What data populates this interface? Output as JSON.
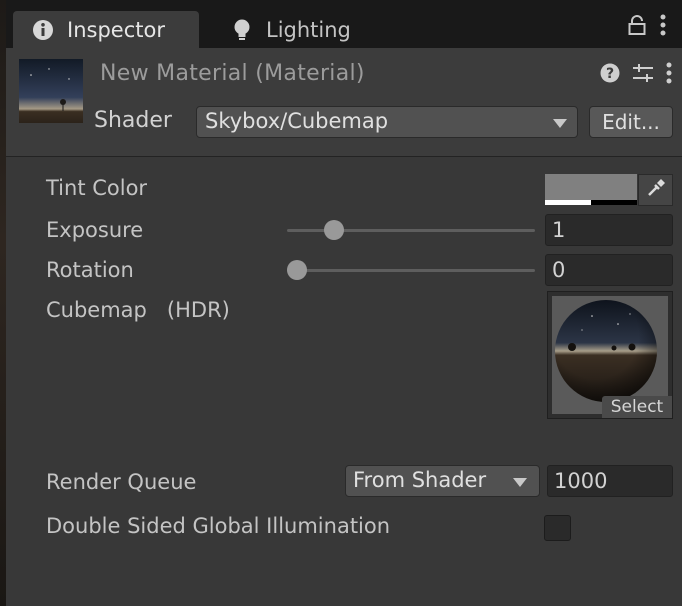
{
  "tabs": [
    {
      "label": "Inspector",
      "icon": "info-icon"
    },
    {
      "label": "Lighting",
      "icon": "lightbulb-icon"
    }
  ],
  "tabbar_icons": [
    "lock-icon",
    "kebab-menu-icon"
  ],
  "material": {
    "title": "New Material (Material)",
    "header_icons": [
      "help-icon",
      "preset-sliders-icon",
      "kebab-menu-icon"
    ],
    "shader_label": "Shader",
    "shader_value": "Skybox/Cubemap",
    "edit_label": "Edit..."
  },
  "properties": {
    "tint": {
      "label": "Tint Color",
      "color": "#808080",
      "alpha": 0.5
    },
    "exposure": {
      "label": "Exposure",
      "value": "1",
      "slider_fraction": 0.15
    },
    "rotation": {
      "label": "Rotation",
      "value": "0",
      "slider_fraction": 0.0
    },
    "cubemap": {
      "label": "Cubemap",
      "hint": "(HDR)",
      "select_label": "Select"
    },
    "render_queue": {
      "label": "Render Queue",
      "mode": "From Shader",
      "value": "1000"
    },
    "dsgi": {
      "label": "Double Sided Global Illumination",
      "checked": false
    }
  },
  "colors": {
    "background": "#383838",
    "tabbar": "#191919",
    "field": "#2a2a2a",
    "dropdown": "#515151"
  }
}
